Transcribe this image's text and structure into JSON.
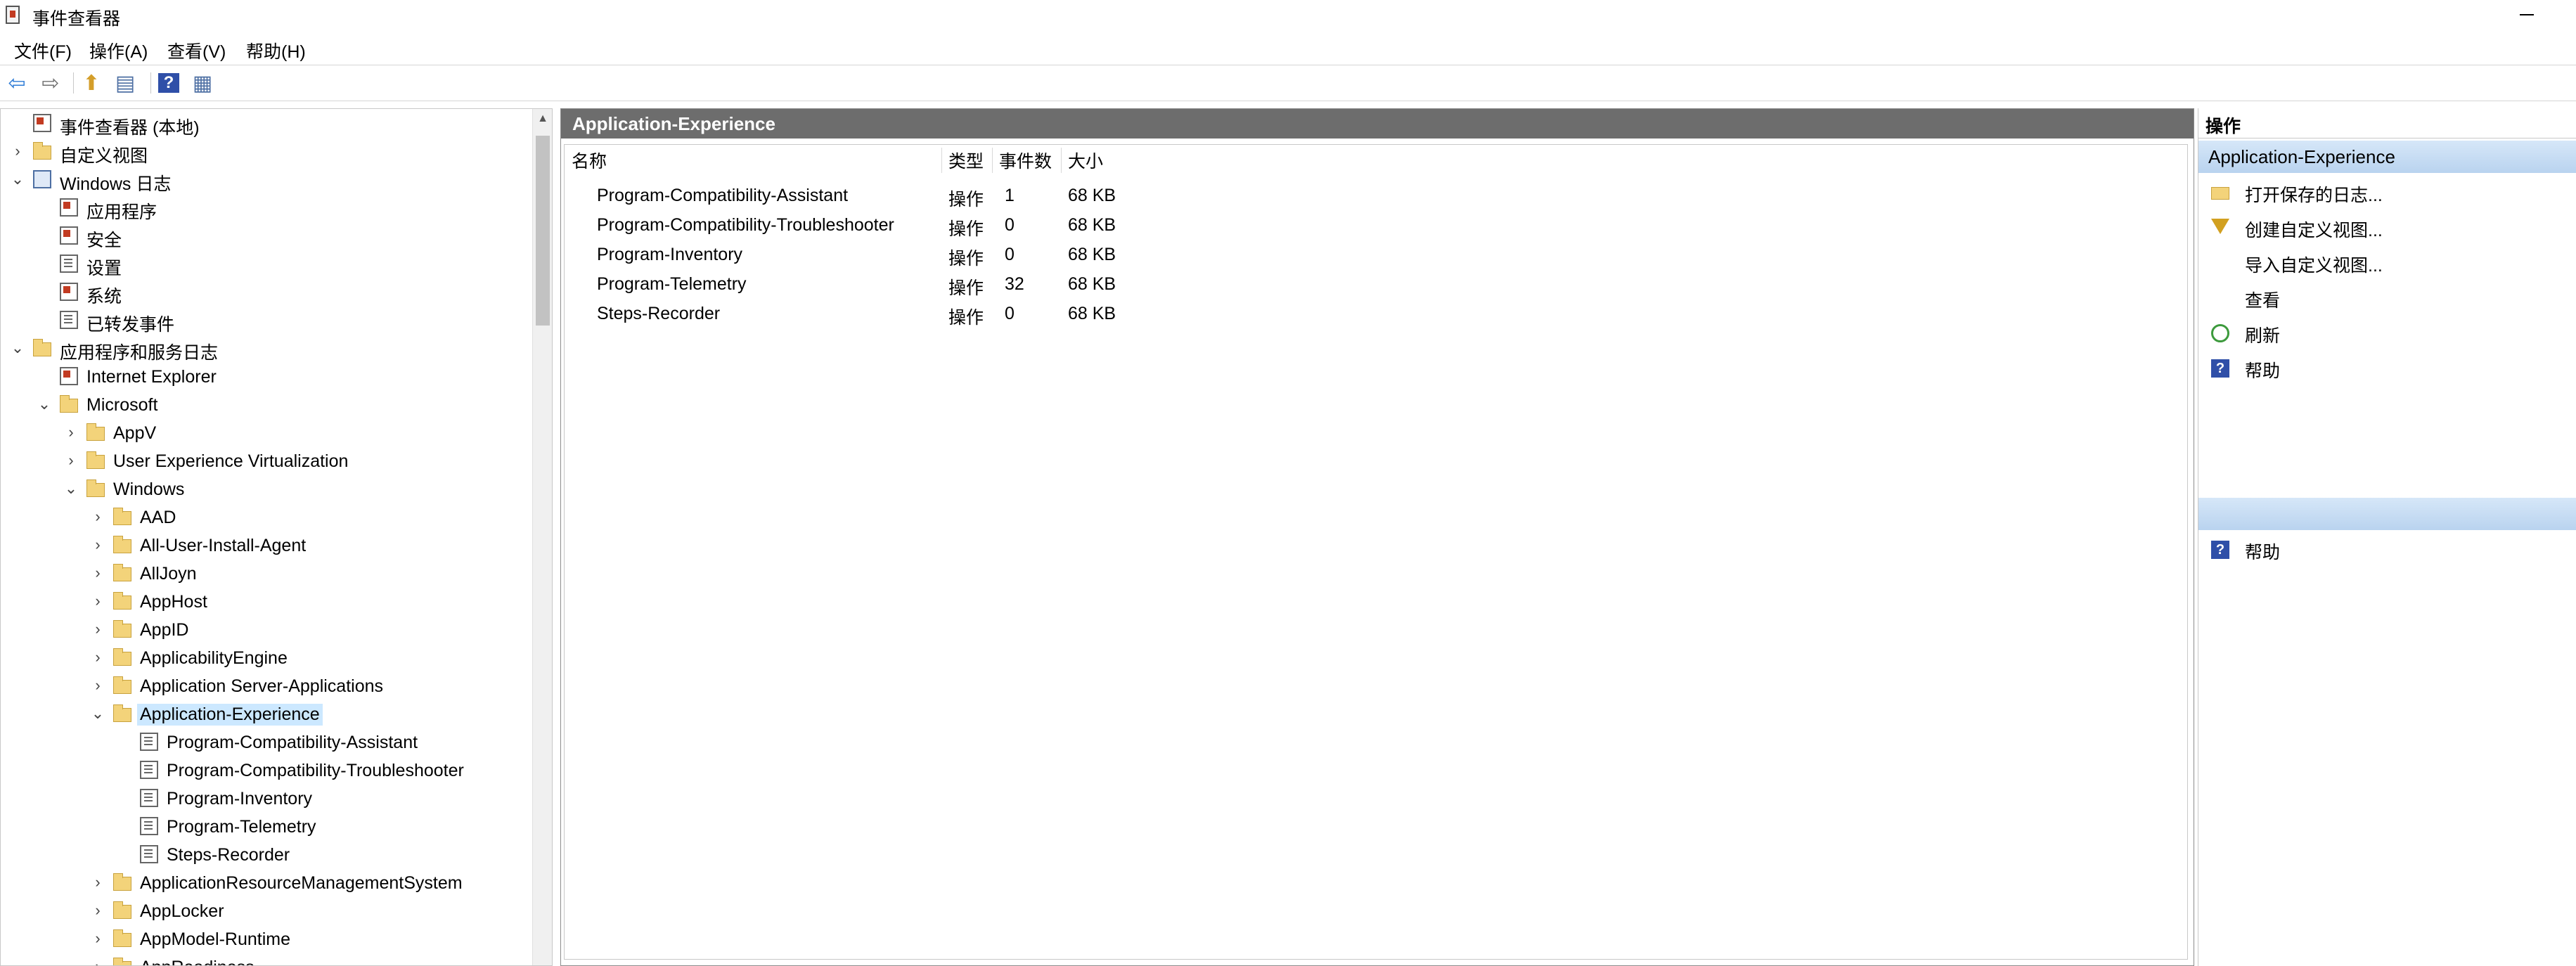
{
  "window": {
    "title": "事件查看器"
  },
  "menu": [
    "文件(F)",
    "操作(A)",
    "查看(V)",
    "帮助(H)"
  ],
  "toolbar": [
    {
      "name": "back-arrow-icon",
      "glyph": "⇦",
      "color": "#2c7bd6"
    },
    {
      "name": "forward-arrow-icon",
      "glyph": "⇨",
      "color": "#6f6f6f"
    },
    {
      "name": "up-folder-icon",
      "glyph": "⬆",
      "color": "#d49e2a"
    },
    {
      "name": "show-hide-tree-icon",
      "glyph": "▤",
      "color": "#4d6fa3"
    },
    {
      "name": "help-icon",
      "glyph": "?",
      "color": "#ffffff"
    },
    {
      "name": "show-hide-action-pane-icon",
      "glyph": "▦",
      "color": "#4d6fa3"
    }
  ],
  "tree": [
    {
      "label": "事件查看器 (本地)",
      "level": 0,
      "chevron": "",
      "icon": "applog"
    },
    {
      "label": "自定义视图",
      "level": 0,
      "chevron": "›",
      "icon": "folder"
    },
    {
      "label": "Windows 日志",
      "level": 0,
      "chevron": "⌄",
      "icon": "monitor"
    },
    {
      "label": "应用程序",
      "level": 1,
      "chevron": "",
      "icon": "applog"
    },
    {
      "label": "安全",
      "level": 1,
      "chevron": "",
      "icon": "applog"
    },
    {
      "label": "设置",
      "level": 1,
      "chevron": "",
      "icon": "log"
    },
    {
      "label": "系统",
      "level": 1,
      "chevron": "",
      "icon": "applog"
    },
    {
      "label": "已转发事件",
      "level": 1,
      "chevron": "",
      "icon": "log"
    },
    {
      "label": "应用程序和服务日志",
      "level": 0,
      "chevron": "⌄",
      "icon": "folder"
    },
    {
      "label": "Internet Explorer",
      "level": 1,
      "chevron": "",
      "icon": "applog"
    },
    {
      "label": "Microsoft",
      "level": 1,
      "chevron": "⌄",
      "icon": "folder"
    },
    {
      "label": "AppV",
      "level": 2,
      "chevron": "›",
      "icon": "folder"
    },
    {
      "label": "User Experience Virtualization",
      "level": 2,
      "chevron": "›",
      "icon": "folder"
    },
    {
      "label": "Windows",
      "level": 2,
      "chevron": "⌄",
      "icon": "folder"
    },
    {
      "label": "AAD",
      "level": 3,
      "chevron": "›",
      "icon": "folder"
    },
    {
      "label": "All-User-Install-Agent",
      "level": 3,
      "chevron": "›",
      "icon": "folder"
    },
    {
      "label": "AllJoyn",
      "level": 3,
      "chevron": "›",
      "icon": "folder"
    },
    {
      "label": "AppHost",
      "level": 3,
      "chevron": "›",
      "icon": "folder"
    },
    {
      "label": "AppID",
      "level": 3,
      "chevron": "›",
      "icon": "folder"
    },
    {
      "label": "ApplicabilityEngine",
      "level": 3,
      "chevron": "›",
      "icon": "folder"
    },
    {
      "label": "Application Server-Applications",
      "level": 3,
      "chevron": "›",
      "icon": "folder"
    },
    {
      "label": "Application-Experience",
      "level": 3,
      "chevron": "⌄",
      "icon": "folder",
      "selected": true
    },
    {
      "label": "Program-Compatibility-Assistant",
      "level": 4,
      "chevron": "",
      "icon": "log"
    },
    {
      "label": "Program-Compatibility-Troubleshooter",
      "level": 4,
      "chevron": "",
      "icon": "log"
    },
    {
      "label": "Program-Inventory",
      "level": 4,
      "chevron": "",
      "icon": "log"
    },
    {
      "label": "Program-Telemetry",
      "level": 4,
      "chevron": "",
      "icon": "log"
    },
    {
      "label": "Steps-Recorder",
      "level": 4,
      "chevron": "",
      "icon": "log"
    },
    {
      "label": "ApplicationResourceManagementSystem",
      "level": 3,
      "chevron": "›",
      "icon": "folder"
    },
    {
      "label": "AppLocker",
      "level": 3,
      "chevron": "›",
      "icon": "folder"
    },
    {
      "label": "AppModel-Runtime",
      "level": 3,
      "chevron": "›",
      "icon": "folder"
    },
    {
      "label": "AppReadiness",
      "level": 3,
      "chevron": "›",
      "icon": "folder"
    }
  ],
  "main": {
    "header": "Application-Experience",
    "columns": [
      "名称",
      "类型",
      "事件数",
      "大小"
    ],
    "rows": [
      {
        "name": "Program-Compatibility-Assistant",
        "type": "操作",
        "count": "1",
        "size": "68 KB"
      },
      {
        "name": "Program-Compatibility-Troubleshooter",
        "type": "操作",
        "count": "0",
        "size": "68 KB"
      },
      {
        "name": "Program-Inventory",
        "type": "操作",
        "count": "0",
        "size": "68 KB"
      },
      {
        "name": "Program-Telemetry",
        "type": "操作",
        "count": "32",
        "size": "68 KB"
      },
      {
        "name": "Steps-Recorder",
        "type": "操作",
        "count": "0",
        "size": "68 KB"
      }
    ]
  },
  "actions": {
    "title": "操作",
    "section1": "Application-Experience",
    "items1": [
      {
        "label": "打开保存的日志...",
        "icon": "open"
      },
      {
        "label": "创建自定义视图...",
        "icon": "filter"
      },
      {
        "label": "导入自定义视图...",
        "icon": ""
      },
      {
        "label": "查看",
        "icon": ""
      },
      {
        "label": "刷新",
        "icon": "refresh"
      },
      {
        "label": "帮助",
        "icon": "help"
      }
    ],
    "section2": "",
    "items2": [
      {
        "label": "帮助",
        "icon": "help"
      }
    ]
  }
}
